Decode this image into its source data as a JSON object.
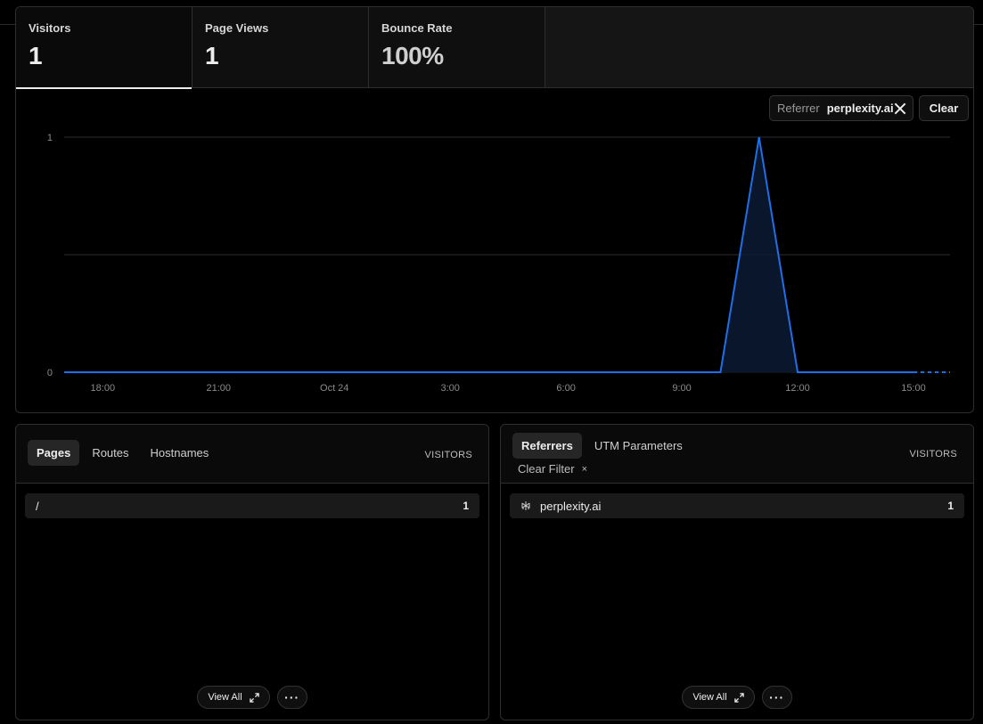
{
  "metrics": [
    {
      "label": "Visitors",
      "value": "1"
    },
    {
      "label": "Page Views",
      "value": "1"
    },
    {
      "label": "Bounce Rate",
      "value": "100%"
    }
  ],
  "filter": {
    "key": "Referrer",
    "value": "perplexity.ai",
    "remove_icon": "close-icon"
  },
  "clear_label": "Clear",
  "chart_data": {
    "type": "line",
    "x_tick_labels": [
      "18:00",
      "21:00",
      "Oct 24",
      "3:00",
      "6:00",
      "9:00",
      "12:00",
      "15:00"
    ],
    "y_tick_labels": [
      "1",
      "0"
    ],
    "ylim": [
      0,
      1
    ],
    "series": [
      {
        "color": "#1e6fe8",
        "x": [
          "17:00",
          "18:00",
          "19:00",
          "20:00",
          "21:00",
          "22:00",
          "23:00",
          "Oct 24",
          "1:00",
          "2:00",
          "3:00",
          "4:00",
          "5:00",
          "6:00",
          "7:00",
          "8:00",
          "9:00",
          "10:00",
          "11:00",
          "12:00",
          "13:00",
          "14:00",
          "15:00",
          "16:00"
        ],
        "values": [
          0,
          0,
          0,
          0,
          0,
          0,
          0,
          0,
          0,
          0,
          0,
          0,
          0,
          0,
          0,
          0,
          0,
          0,
          1,
          0,
          0,
          0,
          0,
          0
        ],
        "last_segment_dashed": true
      }
    ],
    "grid": true
  },
  "pages_panel": {
    "tabs": [
      "Pages",
      "Routes",
      "Hostnames"
    ],
    "column_header": "VISITORS",
    "rows": [
      {
        "label": "/",
        "count": "1"
      }
    ],
    "view_all": "View All",
    "more": "···"
  },
  "referrers_panel": {
    "tabs": [
      "Referrers",
      "UTM Parameters"
    ],
    "column_header": "VISITORS",
    "clear_filter": "Clear Filter",
    "clear_filter_icon": "×",
    "rows": [
      {
        "label": "perplexity.ai",
        "count": "1",
        "icon": "perplexity-icon"
      }
    ],
    "view_all": "View All",
    "more": "···"
  }
}
